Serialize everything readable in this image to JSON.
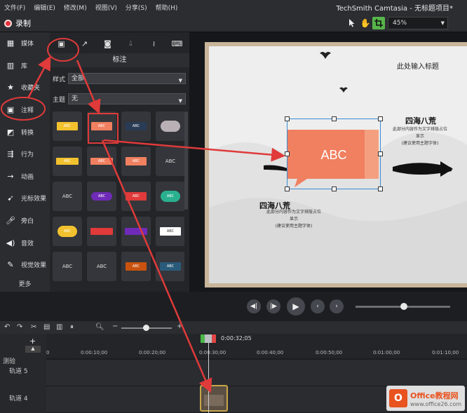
{
  "menubar": {
    "items": [
      "文件(F)",
      "编辑(E)",
      "修改(M)",
      "视图(V)",
      "分享(S)",
      "帮助(H)"
    ],
    "title": "TechSmith Camtasia - 无标题项目*"
  },
  "toolbar": {
    "record_label": "录制",
    "zoom_value": "45%"
  },
  "leftnav": {
    "items": [
      {
        "label": "媒体",
        "icon": "film-icon"
      },
      {
        "label": "库",
        "icon": "library-icon"
      },
      {
        "label": "收藏夹",
        "icon": "star-icon"
      },
      {
        "label": "注释",
        "icon": "annotation-icon"
      },
      {
        "label": "转换",
        "icon": "transition-icon"
      },
      {
        "label": "行为",
        "icon": "behavior-icon"
      },
      {
        "label": "动画",
        "icon": "animation-icon"
      },
      {
        "label": "光标效果",
        "icon": "cursor-icon"
      },
      {
        "label": "旁白",
        "icon": "mic-icon"
      },
      {
        "label": "音效",
        "icon": "speaker-icon"
      },
      {
        "label": "视觉效果",
        "icon": "wand-icon"
      }
    ],
    "more_label": "更多"
  },
  "panel": {
    "title": "标注",
    "style_label": "样式",
    "style_value": "全部",
    "theme_label": "主题",
    "theme_value": "无",
    "tiles": [
      {
        "text": "ABC",
        "color": "#f2c12e",
        "kind": "bubble"
      },
      {
        "text": "ABC",
        "color": "#f08060",
        "kind": "bubble"
      },
      {
        "text": "ABC",
        "color": "#2a3b55",
        "kind": "bubble"
      },
      {
        "text": "",
        "color": "#b8b0b4",
        "kind": "cloud"
      },
      {
        "text": "ABC",
        "color": "#f2c12e",
        "kind": "arrow"
      },
      {
        "text": "ABC",
        "color": "#f08060",
        "kind": "arrow"
      },
      {
        "text": "ABC",
        "color": "#f08060",
        "kind": "rect"
      },
      {
        "text": "ABC",
        "color": "",
        "kind": "text"
      },
      {
        "text": "ABC",
        "color": "",
        "kind": "text"
      },
      {
        "text": "ABC",
        "color": "#6f2bb8",
        "kind": "pill"
      },
      {
        "text": "ABC",
        "color": "#e03a3a",
        "kind": "bubble"
      },
      {
        "text": "ABC",
        "color": "#2ab08f",
        "kind": "cloud"
      },
      {
        "text": "ABC",
        "color": "#f2c12e",
        "kind": "cloud"
      },
      {
        "text": "",
        "color": "#e03a3a",
        "kind": "arrow"
      },
      {
        "text": "",
        "color": "#6f2bb8",
        "kind": "arrow"
      },
      {
        "text": "ABC",
        "color": "#ffffff",
        "kind": "rect"
      },
      {
        "text": "ABC",
        "color": "",
        "kind": "text"
      },
      {
        "text": "ABC",
        "color": "",
        "kind": "text"
      },
      {
        "text": "ABC",
        "color": "#c9520f",
        "kind": "rect"
      },
      {
        "text": "ABC",
        "color": "#2a5a7a",
        "kind": "rect"
      }
    ]
  },
  "slide": {
    "title": "此处输入标题",
    "heading1": "四海八荒",
    "body1": [
      "此部分内容作为文字排版占位",
      "显示",
      "(建议使用主题字体)"
    ],
    "heading2": "四海八荒",
    "body2": [
      "此部分内容作为文字排版占位",
      "显示",
      "(建议使用主题字体)"
    ],
    "callout_text": "ABC",
    "callout_color": "#f08060"
  },
  "timeline": {
    "playhead_time": "0:00:32;05",
    "ticks": [
      "0",
      "0:00:10;00",
      "0:00:20;00",
      "0:00:30;00",
      "0:00:40;00",
      "0:00:50;00",
      "0:01:00;00",
      "0:01:10;00"
    ],
    "test_label": "测验",
    "tracks": [
      "轨道 5",
      "轨道 4"
    ]
  },
  "watermark": {
    "text1": "Office教程网",
    "text2": "www.office26.com"
  },
  "colors": {
    "accent_green": "#57b64a",
    "annotation_red": "#e03a3a",
    "record_red": "#e8303a"
  }
}
